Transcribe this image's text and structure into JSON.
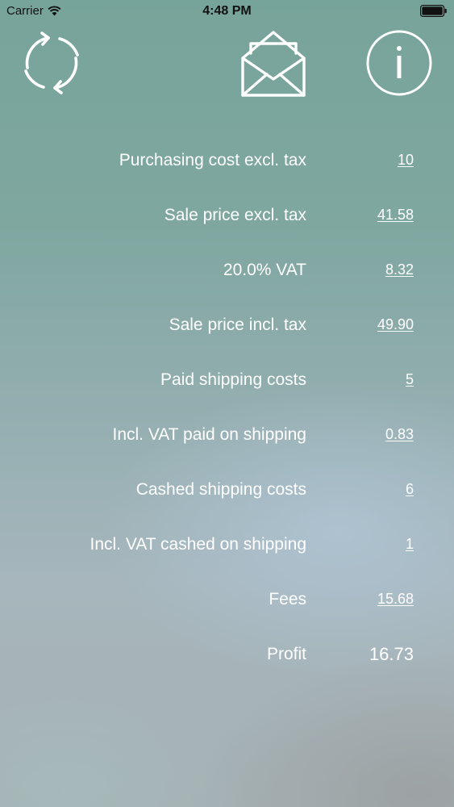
{
  "status_bar": {
    "carrier": "Carrier",
    "time": "4:48 PM",
    "icons": [
      "wifi-icon",
      "battery-icon"
    ]
  },
  "toolbar": {
    "icons": [
      "refresh-icon",
      "mail-icon",
      "info-icon"
    ]
  },
  "rows": [
    {
      "label": "Purchasing cost excl. tax",
      "value": "10",
      "editable": true
    },
    {
      "label": "Sale price excl. tax",
      "value": "41.58",
      "editable": true
    },
    {
      "label": "20.0% VAT",
      "value": "8.32",
      "editable": true
    },
    {
      "label": "Sale price incl. tax",
      "value": "49.90",
      "editable": true
    },
    {
      "label": "Paid shipping costs",
      "value": "5",
      "editable": true
    },
    {
      "label": "Incl. VAT paid on shipping",
      "value": "0.83",
      "editable": true
    },
    {
      "label": "Cashed shipping costs",
      "value": "6",
      "editable": true
    },
    {
      "label": "Incl. VAT cashed on shipping",
      "value": "1",
      "editable": true
    },
    {
      "label": "Fees",
      "value": "15.68",
      "editable": true
    },
    {
      "label": "Profit",
      "value": "16.73",
      "editable": false
    }
  ]
}
